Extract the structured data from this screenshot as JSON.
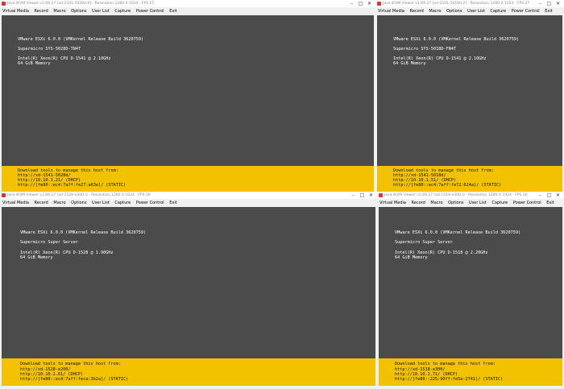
{
  "windows": [
    {
      "title": "Java iKVM Viewer v1.69.27 [ad-1541-5028d-4] - Resolution 1280 X 1024 - FPS 27",
      "menu": [
        "Virtual Media",
        "Record",
        "Macro",
        "Options",
        "User List",
        "Capture",
        "Power Control",
        "Exit"
      ],
      "console": {
        "line1": "VMware ESXi 6.0.0 (VMKernel Release Build 3620759)",
        "line2": "Supermicro SYS-5028D-TN4T",
        "line3": "Intel(R) Xeon(R) CPU D-1541 @ 2.10GHz",
        "line4": "64 GiB Memory"
      },
      "band": {
        "line1": "Download tools to manage this host from:",
        "line2": "http://xd-1541-5028d/",
        "line3": "http://10.10.1.21/ (DHCP)",
        "line4": "http://[fe80::ec4:7aff:fe27:a63e]/ (STATIC)"
      }
    },
    {
      "title": "Java iKVM Viewer v1.69.27 [ad-1541-5018d-2] - Resolution 1280 X 1024 - FPS 27",
      "menu": [
        "Virtual Media",
        "Record",
        "Macro",
        "Options",
        "User List",
        "Capture",
        "Power Control",
        "Exit"
      ],
      "console": {
        "line1": "VMware ESXi 6.0.0 (VMKernel Release Build 3620759)",
        "line2": "Supermicro SYS-5018D-FN4T",
        "line3": "Intel(R) Xeon(R) CPU D-1541 @ 2.10GHz",
        "line4": "64 GiB Memory"
      },
      "band": {
        "line1": "Download tools to manage this host from:",
        "line2": "http://xd-1541-5018d/",
        "line3": "http://10.10.1.51/ (DHCP)",
        "line4": "http://[fe80::ec4:7aff:fe72:624a]/ (STATIC)"
      }
    },
    {
      "title": "Java iKVM Viewer v1.69.27 [ad-1528-e200-i] - Resolution 1280 X 1024 - FPS 26",
      "menu": [
        "Virtual Media",
        "Record",
        "Macro",
        "Options",
        "User List",
        "Capture",
        "Power Control",
        "Exit"
      ],
      "console": {
        "line1": "VMware ESXi 6.0.0 (VMKernel Release Build 3620759)",
        "line2": "Supermicro Super Server",
        "line3": "Intel(R) Xeon(R) CPU D-1528 @ 1.90GHz",
        "line4": "64 GiB Memory"
      },
      "band": {
        "line1": "Download tools to manage this host from:",
        "line2": "http://xd-1528-e200/",
        "line3": "http://10.10.1.61/ (DHCP)",
        "line4": "http://[fe80::ec4:7aff:feca:3b2a]/ (STATIC)"
      }
    },
    {
      "title": "Java iKVM Viewer v1.69.27 [ad-1518-e300-i] - Resolution 1280 X 1024 - FPS 26",
      "menu": [
        "Virtual Media",
        "Record",
        "Macro",
        "Options",
        "User List",
        "Capture",
        "Power Control",
        "Exit"
      ],
      "console": {
        "line1": "VMware ESXi 6.0.0 (VMKernel Release Build 3620759)",
        "line2": "Supermicro Super Server",
        "line3": "Intel(R) Xeon(R) CPU D-1518 @ 2.20GHz",
        "line4": "64 GiB Memory"
      },
      "band": {
        "line1": "Download tools to manage this host from:",
        "line2": "http://xd-1518-e300/",
        "line3": "http://10.10.1.71/ (DHCP)",
        "line4": "http://[fe80::225:90ff:fe5e:2741]/ (STATIC)"
      }
    }
  ],
  "window_controls": [
    "–",
    "□",
    "✕"
  ],
  "colors": {
    "console_bg": "#4b4b4b",
    "band": "#f2c200",
    "console_text": "#ffffff"
  }
}
